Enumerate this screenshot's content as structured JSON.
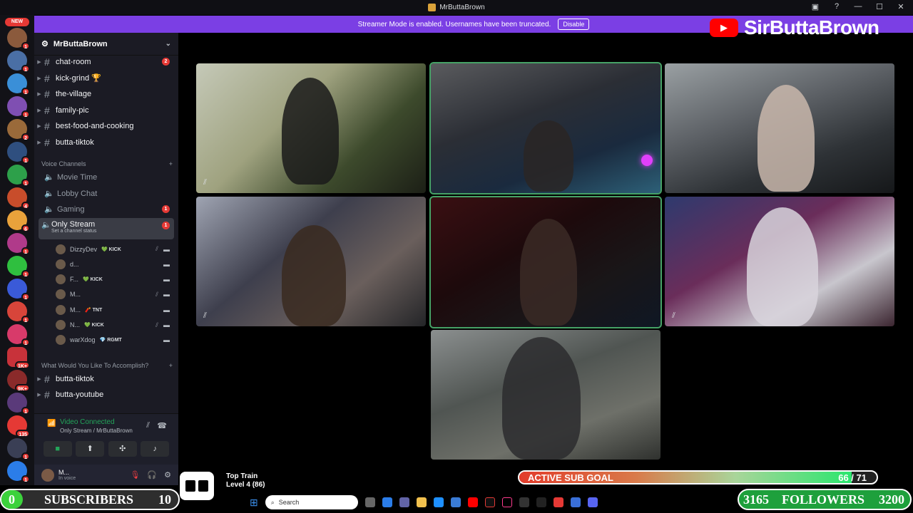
{
  "window": {
    "title": "MrButtaBrown"
  },
  "banner": {
    "text": "Streamer Mode is enabled. Usernames have been truncated.",
    "button": "Disable"
  },
  "overlay": {
    "youtube_name": "SirButtaBrown"
  },
  "server_rail": {
    "new_label": "NEW",
    "badges": [
      "1",
      "1",
      "1",
      "1",
      "2",
      "1",
      "1",
      "4",
      "6",
      "1",
      "1",
      "1",
      "1",
      "1",
      "1K+",
      "9K+",
      "1",
      "135",
      "1",
      "1"
    ]
  },
  "guild": {
    "name": "MrButtaBrown"
  },
  "channels": [
    {
      "name": "chat-room",
      "badge": "2"
    },
    {
      "name": "kick-grind 🏆"
    },
    {
      "name": "the-village"
    },
    {
      "name": "family-pic"
    },
    {
      "name": "best-food-and-cooking"
    },
    {
      "name": "butta-tiktok"
    }
  ],
  "voice_category": "Voice Channels",
  "voice_channels": [
    {
      "name": "Movie Time"
    },
    {
      "name": "Lobby Chat"
    },
    {
      "name": "Gaming",
      "badge": "1"
    },
    {
      "name": "Only Stream",
      "badge": "1",
      "status": "Set a channel status"
    }
  ],
  "voice_users": [
    {
      "name": "DizzyDev",
      "tag": "💚 KICK"
    },
    {
      "name": "d...",
      "tag": ""
    },
    {
      "name": "F...",
      "tag": "💚 KICK"
    },
    {
      "name": "M...",
      "tag": ""
    },
    {
      "name": "M...",
      "tag": "🧨 TNT"
    },
    {
      "name": "N...",
      "tag": "💚 KICK"
    },
    {
      "name": "warXdog",
      "tag": "💎 RGMT"
    }
  ],
  "category2": "What Would You Like To Accomplish?",
  "channels2": [
    {
      "name": "butta-tiktok"
    },
    {
      "name": "butta-youtube"
    }
  ],
  "voice_connected": {
    "status": "Video Connected",
    "channel": "Only Stream / MrButtaBrown"
  },
  "user_panel": {
    "name": "M...",
    "status": "In voice"
  },
  "sub_goal": {
    "label": "ACTIVE SUB GOAL",
    "current": 66,
    "target": 71,
    "display": "66 / 71"
  },
  "top_train": {
    "title": "Top Train",
    "level": "Level 4 (86)"
  },
  "subscribers": {
    "current": "0",
    "label": "SUBSCRIBERS",
    "target": "10"
  },
  "followers": {
    "current": "3165",
    "label": "FOLLOWERS",
    "target": "3200"
  },
  "taskbar": {
    "search_placeholder": "Search"
  }
}
